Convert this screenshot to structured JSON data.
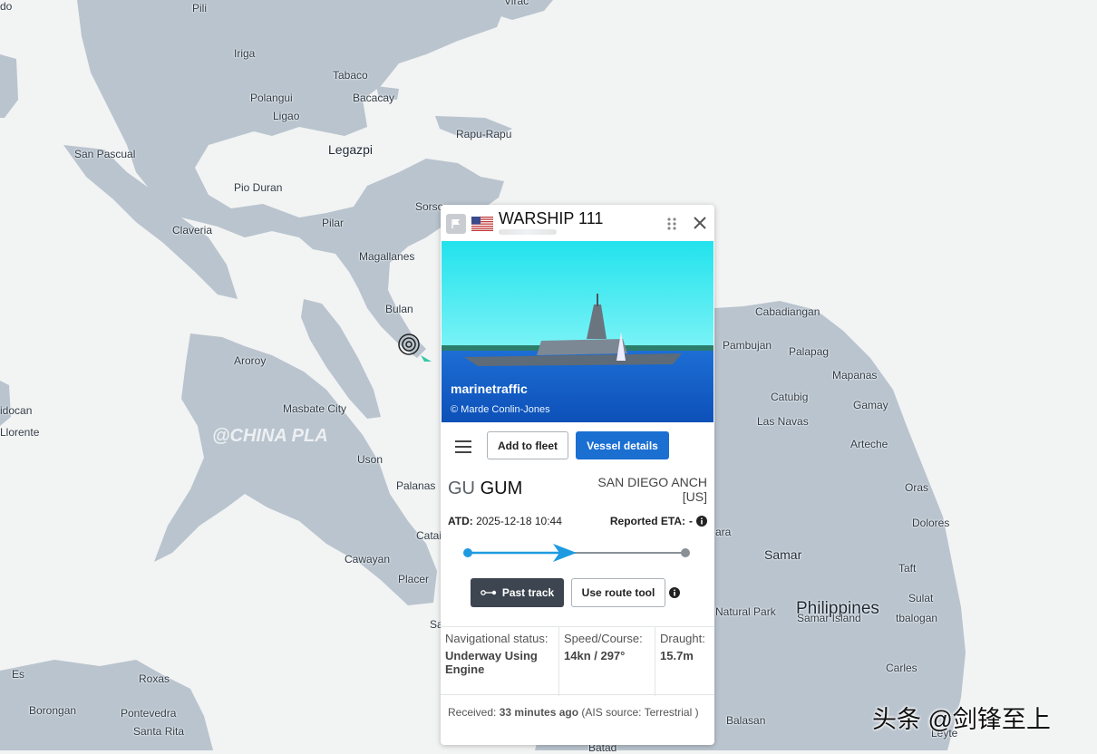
{
  "map": {
    "places": [
      {
        "name": "Pili",
        "cls": ""
      },
      {
        "name": "Virac",
        "cls": ""
      },
      {
        "name": "Iriga",
        "cls": ""
      },
      {
        "name": "Tabaco",
        "cls": ""
      },
      {
        "name": "Polangui",
        "cls": ""
      },
      {
        "name": "Bacacay",
        "cls": ""
      },
      {
        "name": "Ligao",
        "cls": ""
      },
      {
        "name": "Rapu-Rapu",
        "cls": ""
      },
      {
        "name": "Legazpi",
        "cls": "big"
      },
      {
        "name": "San Pascual",
        "cls": ""
      },
      {
        "name": "Pio Duran",
        "cls": ""
      },
      {
        "name": "Sorso",
        "cls": ""
      },
      {
        "name": "Pilar",
        "cls": ""
      },
      {
        "name": "Claveria",
        "cls": ""
      },
      {
        "name": "Magallanes",
        "cls": ""
      },
      {
        "name": "Bulan",
        "cls": ""
      },
      {
        "name": "Cabadiangan",
        "cls": ""
      },
      {
        "name": "Pambujan",
        "cls": ""
      },
      {
        "name": "Palapag",
        "cls": ""
      },
      {
        "name": "Aroroy",
        "cls": ""
      },
      {
        "name": "Mapanas",
        "cls": ""
      },
      {
        "name": "Catubig",
        "cls": ""
      },
      {
        "name": "Gamay",
        "cls": ""
      },
      {
        "name": "Las Navas",
        "cls": ""
      },
      {
        "name": "idocan",
        "cls": ""
      },
      {
        "name": "Masbate City",
        "cls": ""
      },
      {
        "name": "Arteche",
        "cls": ""
      },
      {
        "name": "Uson",
        "cls": ""
      },
      {
        "name": "Oras",
        "cls": ""
      },
      {
        "name": "Palanas",
        "cls": ""
      },
      {
        "name": "Dolores",
        "cls": ""
      },
      {
        "name": "Catai",
        "cls": ""
      },
      {
        "name": "ara",
        "cls": ""
      },
      {
        "name": "Samar",
        "cls": "big"
      },
      {
        "name": "Cawayan",
        "cls": ""
      },
      {
        "name": "Taft",
        "cls": ""
      },
      {
        "name": "Placer",
        "cls": ""
      },
      {
        "name": "Sulat",
        "cls": ""
      },
      {
        "name": "Philippines",
        "cls": "country"
      },
      {
        "name": "Samar Island",
        "cls": ""
      },
      {
        "name": "Natural Park",
        "cls": ""
      },
      {
        "name": "tbalogan",
        "cls": ""
      },
      {
        "name": "San Julian",
        "cls": ""
      },
      {
        "name": "Es",
        "cls": ""
      },
      {
        "name": "Roxas",
        "cls": ""
      },
      {
        "name": "Carles",
        "cls": ""
      },
      {
        "name": "Borongan",
        "cls": ""
      },
      {
        "name": "Pontevedra",
        "cls": ""
      },
      {
        "name": "Balasan",
        "cls": ""
      },
      {
        "name": "Santa Rita",
        "cls": ""
      },
      {
        "name": "Batad",
        "cls": ""
      },
      {
        "name": "Leyte",
        "cls": ""
      },
      {
        "name": "Llorente",
        "cls": ""
      },
      {
        "name": "do",
        "cls": ""
      }
    ],
    "watermark": "@CHINA PLA",
    "corner_watermark": "头条 @剑锋至上"
  },
  "popup": {
    "vessel_name": "WARSHIP 111",
    "flag": "us-flag",
    "photo": {
      "brand": "marinetraffic",
      "credit": "© Marde Conlin-Jones"
    },
    "buttons": {
      "add_to_fleet": "Add to fleet",
      "vessel_details": "Vessel details",
      "past_track": "Past track",
      "use_route_tool": "Use route tool"
    },
    "destination": {
      "country_code": "GU",
      "port": "GUM"
    },
    "origin": {
      "name": "SAN DIEGO ANCH",
      "country": "[US]"
    },
    "atd": {
      "label": "ATD:",
      "value": "2025-12-18 10:44"
    },
    "eta": {
      "label": "Reported ETA:",
      "value": "-"
    },
    "voyage_progress": 0.45,
    "stats": {
      "nav_status_label": "Navigational status:",
      "nav_status_value": "Underway Using Engine",
      "speed_course_label": "Speed/Course:",
      "speed_course_value": "14kn / 297°",
      "draught_label": "Draught:",
      "draught_value": "15.7m"
    },
    "received": {
      "label": "Received:",
      "value": "33 minutes ago",
      "source": "(AIS source: Terrestrial )"
    }
  },
  "colors": {
    "land": "#b9c4ce",
    "water": "#f2f3f3",
    "primary": "#1a6fd1",
    "track": "#1e9be0"
  }
}
